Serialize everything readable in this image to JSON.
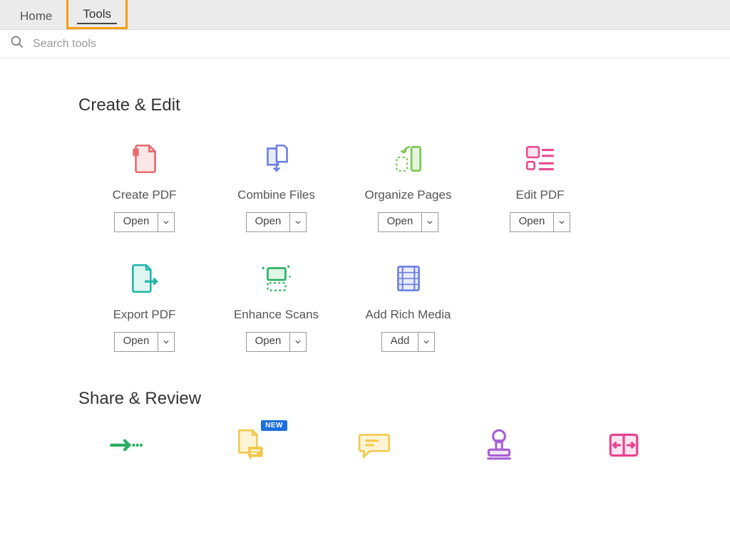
{
  "tabs": {
    "home": "Home",
    "tools": "Tools"
  },
  "search": {
    "placeholder": "Search tools"
  },
  "sections": {
    "create_edit": "Create & Edit",
    "share_review": "Share & Review"
  },
  "buttons": {
    "open": "Open",
    "add": "Add"
  },
  "badge": {
    "new": "NEW"
  },
  "tools": {
    "create_pdf": {
      "label": "Create PDF",
      "action": "open"
    },
    "combine_files": {
      "label": "Combine Files",
      "action": "open"
    },
    "organize_pages": {
      "label": "Organize Pages",
      "action": "open"
    },
    "edit_pdf": {
      "label": "Edit PDF",
      "action": "open"
    },
    "export_pdf": {
      "label": "Export PDF",
      "action": "open"
    },
    "enhance_scans": {
      "label": "Enhance Scans",
      "action": "open"
    },
    "add_rich_media": {
      "label": "Add Rich Media",
      "action": "add"
    }
  },
  "colors": {
    "red": "#e86a6f",
    "blue": "#6c7fe0",
    "green": "#7ac74f",
    "pink": "#e84a8f",
    "teal": "#1fb6a8",
    "yellow": "#f2c94c",
    "purple": "#a75fd6",
    "magenta": "#e8418f",
    "bright_green": "#27ae60"
  }
}
